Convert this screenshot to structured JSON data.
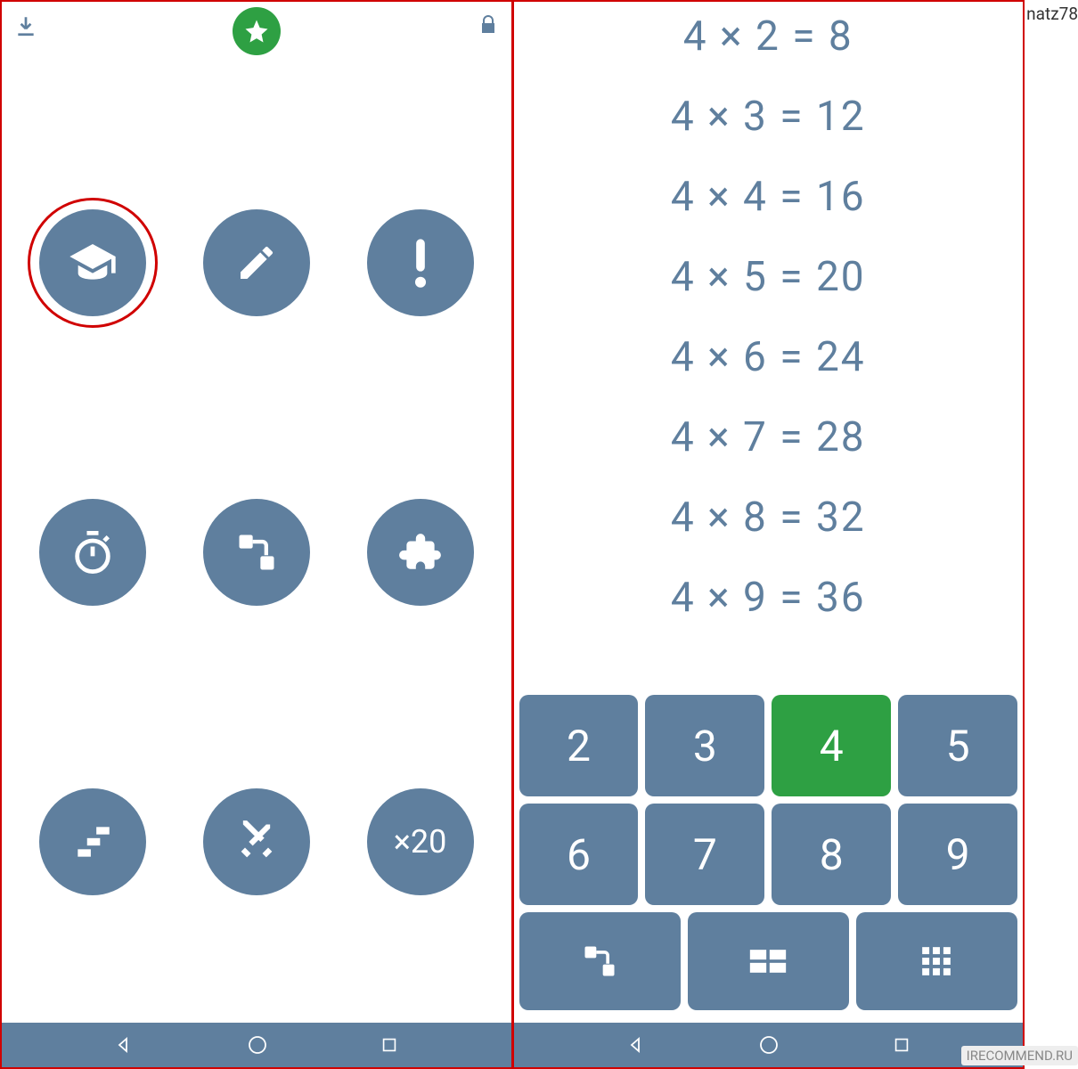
{
  "credit": "natz78",
  "watermark": "IRECOMMEND.RU",
  "left": {
    "menu": [
      {
        "name": "learn",
        "icon": "graduation-cap",
        "selected": true
      },
      {
        "name": "edit",
        "icon": "pencil",
        "selected": false
      },
      {
        "name": "test",
        "icon": "exclamation",
        "selected": false
      },
      {
        "name": "timer",
        "icon": "stopwatch",
        "selected": false
      },
      {
        "name": "path",
        "icon": "flow",
        "selected": false
      },
      {
        "name": "puzzle",
        "icon": "puzzle",
        "selected": false
      },
      {
        "name": "steps",
        "icon": "stairs",
        "selected": false
      },
      {
        "name": "battle",
        "icon": "swords",
        "selected": false
      },
      {
        "name": "x20",
        "label": "×20",
        "selected": false
      }
    ]
  },
  "right": {
    "equations": [
      "4 × 2 = 8",
      "4 × 3 = 12",
      "4 × 4 = 16",
      "4 × 5 = 20",
      "4 × 6 = 24",
      "4 × 7 = 28",
      "4 × 8 = 32",
      "4 × 9 = 36"
    ],
    "keypad": {
      "rows": [
        [
          {
            "l": "2"
          },
          {
            "l": "3"
          },
          {
            "l": "4",
            "active": true
          },
          {
            "l": "5"
          }
        ],
        [
          {
            "l": "6"
          },
          {
            "l": "7"
          },
          {
            "l": "8"
          },
          {
            "l": "9"
          }
        ]
      ],
      "bottom": [
        "flow",
        "grid4",
        "grid12"
      ]
    }
  },
  "colors": {
    "primary": "#5f7f9e",
    "accent": "#2ea043",
    "highlight": "#d00000"
  }
}
